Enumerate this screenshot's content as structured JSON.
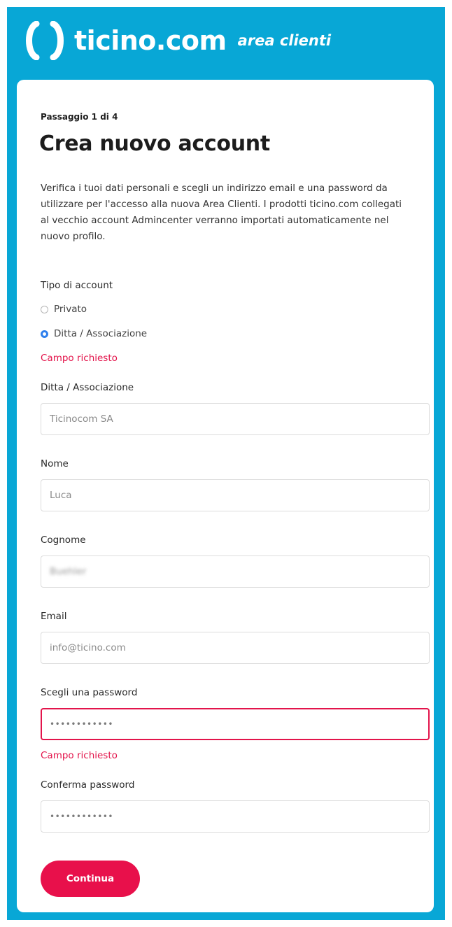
{
  "brand": {
    "name": "ticino.com",
    "subtitle": "area clienti"
  },
  "form": {
    "step": "Passaggio 1 di 4",
    "title": "Crea nuovo account",
    "intro": "Verifica i tuoi dati personali e scegli un indirizzo email e una password da utilizzare per l'accesso alla nuova Area Clienti. I prodotti ticino.com collegati al vecchio account Admincenter verranno importati automaticamente nel nuovo profilo.",
    "account_type": {
      "label": "Tipo di account",
      "options": [
        {
          "label": "Privato",
          "selected": false
        },
        {
          "label": "Ditta / Associazione",
          "selected": true
        }
      ],
      "error": "Campo richiesto"
    },
    "company": {
      "label": "Ditta / Associazione",
      "value": "Ticinocom SA"
    },
    "first_name": {
      "label": "Nome",
      "value": "Luca"
    },
    "last_name": {
      "label": "Cognome",
      "value": "Buehler"
    },
    "email": {
      "label": "Email",
      "value": "info@ticino.com"
    },
    "password": {
      "label": "Scegli una password",
      "value": "••••••••••••",
      "error": "Campo richiesto"
    },
    "confirm_password": {
      "label": "Conferma password",
      "value": "••••••••••••"
    },
    "submit_label": "Continua"
  },
  "colors": {
    "brand_blue": "#08a7d6",
    "accent_red": "#e8104b",
    "radio_blue": "#2f80ed"
  }
}
